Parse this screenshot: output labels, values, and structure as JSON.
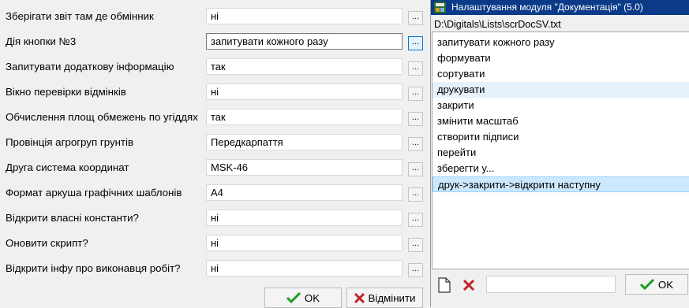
{
  "settings": {
    "rows": [
      {
        "label": "Зберігати звіт там де обмінник",
        "value": "ні"
      },
      {
        "label": "Дія кнопки №3",
        "value": "запитувати кожного разу"
      },
      {
        "label": "Запитувати додаткову інформацію",
        "value": "так"
      },
      {
        "label": "Вікно перевірки відмінків",
        "value": "ні"
      },
      {
        "label": "Обчислення площ обмежень по угіддях",
        "value": "так"
      },
      {
        "label": "Провінція агрогруп грунтів",
        "value": "Передкарпаття"
      },
      {
        "label": "Друга система координат",
        "value": "MSK-46"
      },
      {
        "label": "Формат аркуша графічних шаблонів",
        "value": "A4"
      },
      {
        "label": "Відкрити власні константи?",
        "value": "ні"
      },
      {
        "label": "Оновити скрипт?",
        "value": "ні"
      },
      {
        "label": "Відкрити інфу про виконавця робіт?",
        "value": "ні"
      }
    ],
    "browse_label": "...",
    "ok_label": "OK",
    "cancel_label": "Відмінити"
  },
  "dialog": {
    "title": "Налаштування модуля \"Документація\" (5.0)",
    "path": "D:\\Digitals\\Lists\\scrDocSV.txt",
    "items": [
      "запитувати кожного разу",
      "формувати",
      "сортувати",
      "друкувати",
      "закрити",
      "змінити масштаб",
      "створити підписи",
      "перейти",
      "зберегти у...",
      "друк->закрити->відкрити наступну"
    ],
    "hover_index": 3,
    "selected_index": 9,
    "new_item_value": "",
    "ok_label": "OK"
  },
  "colors": {
    "titlebar": "#0a3a88",
    "ok_check": "#1f9d1f",
    "cancel_x": "#c1272d",
    "selection": "#cce8ff"
  },
  "icons": {
    "ok": "checkmark-icon",
    "cancel": "x-icon",
    "new": "document-icon",
    "delete": "delete-icon",
    "app": "app-icon"
  }
}
